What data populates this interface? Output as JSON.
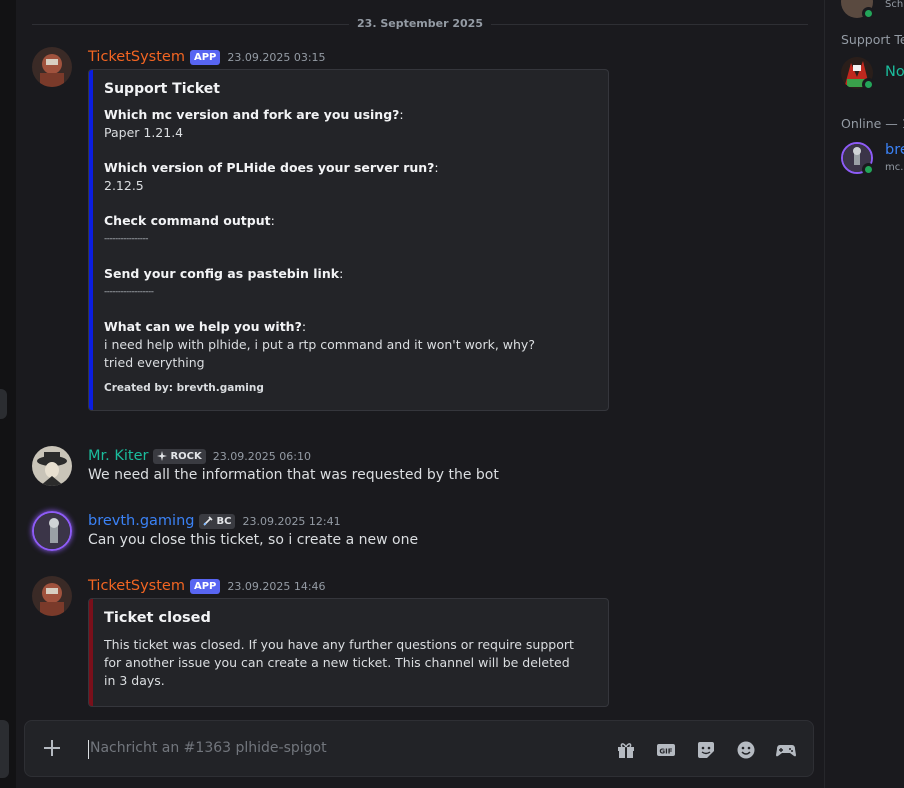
{
  "date_divider": "23. September 2025",
  "colors": {
    "ticket_author": "#f26522",
    "kiter_author": "#1abc9c",
    "brevth_author": "#3b82f6",
    "embed_bar_blue": "#0a1de0",
    "embed_bar_red": "#7a0f1a",
    "app_badge": "#5865f2",
    "online": "#23a559"
  },
  "messages": [
    {
      "author": "TicketSystem",
      "badge": "APP",
      "time": "23.09.2025 03:15",
      "embed": {
        "title": "Support Ticket",
        "fields": [
          {
            "name": "Which mc version and fork are you using?",
            "value": "Paper 1.21.4"
          },
          {
            "name": "Which version of PLHide does your server run?",
            "value": "2.12.5"
          },
          {
            "name": "Check command output",
            "value": "----------------"
          },
          {
            "name": "Send your config as pastebin link",
            "value": "------------------"
          },
          {
            "name": "What can we help you with?",
            "value": "i need help with plhide, i put a rtp command and it won't work, why? tried everything"
          }
        ],
        "footer": "Created by: brevth.gaming"
      }
    },
    {
      "author": "Mr. Kiter",
      "tag": "ROCK",
      "tag_icon": "compass-icon",
      "time": "23.09.2025 06:10",
      "text": "We need all the information that was requested by the bot"
    },
    {
      "author": "brevth.gaming",
      "tag": "BC",
      "tag_icon": "sword-icon",
      "time": "23.09.2025 12:41",
      "text": "Can you close this ticket, so i create a new one"
    },
    {
      "author": "TicketSystem",
      "badge": "APP",
      "time": "23.09.2025 14:46",
      "embed": {
        "title": "Ticket closed",
        "description": "This ticket was closed. If you have any further questions or require support for another issue you can create a new ticket. This channel will be deleted in 3 days."
      }
    }
  ],
  "composer": {
    "placeholder": "Nachricht an #1363 plhide-spigot",
    "icons": [
      "gift-icon",
      "gif-icon",
      "sticker-icon",
      "emoji-icon",
      "activity-icon"
    ]
  },
  "sidebar": {
    "top_partial": "Sch",
    "section_support": "Support Te",
    "support_member": "No",
    "section_online": "Online — 1",
    "online_member": "bre",
    "online_member_sub": "mc."
  }
}
